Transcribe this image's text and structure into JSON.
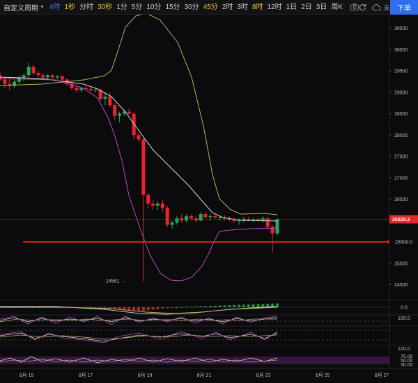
{
  "toolbar": {
    "custom_period": "自定义周期",
    "timeframes": [
      {
        "label": "4时",
        "state": "sel"
      },
      {
        "label": "1秒",
        "state": "active"
      },
      {
        "label": "分时",
        "state": ""
      },
      {
        "label": "30秒",
        "state": "active"
      },
      {
        "label": "1分",
        "state": ""
      },
      {
        "label": "5分",
        "state": ""
      },
      {
        "label": "10分",
        "state": ""
      },
      {
        "label": "15分",
        "state": ""
      },
      {
        "label": "30分",
        "state": ""
      },
      {
        "label": "45分",
        "state": "active"
      },
      {
        "label": "2时",
        "state": ""
      },
      {
        "label": "3时",
        "state": ""
      },
      {
        "label": "8时",
        "state": "active"
      },
      {
        "label": "12时",
        "state": ""
      },
      {
        "label": "1日",
        "state": ""
      },
      {
        "label": "2日",
        "state": ""
      },
      {
        "label": "3日",
        "state": ""
      },
      {
        "label": "周K",
        "state": ""
      }
    ],
    "cloud_label": "未命名",
    "order_button": "下单"
  },
  "chart_data": {
    "type": "candlestick",
    "y_ticks": [
      30500,
      30000,
      29500,
      29000,
      28500,
      28000,
      27500,
      27000,
      26500,
      26000,
      25500,
      25000,
      24500
    ],
    "ylim": [
      24150,
      30820
    ],
    "x_ticks": [
      "8月 15",
      "8月 17",
      "8月 19",
      "8月 21",
      "8月 23",
      "8月 25",
      "8月 27"
    ],
    "current_price": "26029.3",
    "horizontal_line": "25500.0",
    "low_marker": "24581 →",
    "colors": {
      "up": "#26a65b",
      "down": "#e8252d",
      "bb_outer": "#b7b25c",
      "bb_mid": "#d6d6d6",
      "bb_lower": "#b24fb6",
      "hline": "#e01818"
    },
    "candles": [
      [
        29400,
        29480,
        29250,
        29300
      ],
      [
        29300,
        29380,
        29100,
        29200
      ],
      [
        29200,
        29350,
        29050,
        29150
      ],
      [
        29150,
        29300,
        29100,
        29250
      ],
      [
        29250,
        29400,
        29200,
        29350
      ],
      [
        29350,
        29450,
        29250,
        29400
      ],
      [
        29400,
        29700,
        29350,
        29600
      ],
      [
        29600,
        29650,
        29400,
        29450
      ],
      [
        29450,
        29500,
        29350,
        29400
      ],
      [
        29400,
        29450,
        29300,
        29350
      ],
      [
        29350,
        29420,
        29300,
        29400
      ],
      [
        29400,
        29420,
        29320,
        29350
      ],
      [
        29350,
        29400,
        29300,
        29380
      ],
      [
        29380,
        29400,
        29250,
        29300
      ],
      [
        29300,
        29320,
        29150,
        29200
      ],
      [
        29200,
        29250,
        29050,
        29100
      ],
      [
        29100,
        29150,
        29000,
        29050
      ],
      [
        29050,
        29120,
        29000,
        29100
      ],
      [
        29100,
        29150,
        29050,
        29080
      ],
      [
        29080,
        29120,
        29020,
        29050
      ],
      [
        29050,
        29100,
        29000,
        29060
      ],
      [
        29060,
        29080,
        28800,
        28850
      ],
      [
        28850,
        29000,
        28700,
        28900
      ],
      [
        28900,
        29000,
        28650,
        28700
      ],
      [
        28700,
        28750,
        28350,
        28450
      ],
      [
        28450,
        28550,
        28300,
        28500
      ],
      [
        28500,
        28600,
        28450,
        28550
      ],
      [
        28550,
        28620,
        28480,
        28500
      ],
      [
        28500,
        28550,
        27900,
        28000
      ],
      [
        28000,
        28050,
        27850,
        27900
      ],
      [
        27900,
        27950,
        24581,
        26600
      ],
      [
        26600,
        26650,
        26300,
        26400
      ],
      [
        26400,
        26500,
        26250,
        26350
      ],
      [
        26350,
        26450,
        26250,
        26400
      ],
      [
        26400,
        26500,
        26200,
        26300
      ],
      [
        26300,
        26350,
        25850,
        25900
      ],
      [
        25900,
        26000,
        25800,
        25950
      ],
      [
        25950,
        26100,
        25900,
        26050
      ],
      [
        26050,
        26150,
        25950,
        26000
      ],
      [
        26000,
        26150,
        25950,
        26100
      ],
      [
        26100,
        26150,
        26000,
        26050
      ],
      [
        26050,
        26100,
        25950,
        26000
      ],
      [
        26000,
        26200,
        25980,
        26150
      ],
      [
        26150,
        26200,
        26050,
        26080
      ],
      [
        26080,
        26150,
        26000,
        26100
      ],
      [
        26100,
        26180,
        26050,
        26070
      ],
      [
        26070,
        26120,
        26000,
        26080
      ],
      [
        26080,
        26120,
        26000,
        26050
      ],
      [
        26050,
        26100,
        25980,
        26020
      ],
      [
        26020,
        26070,
        25950,
        25990
      ],
      [
        25990,
        26050,
        25900,
        26000
      ],
      [
        26000,
        26080,
        25950,
        26040
      ],
      [
        26040,
        26090,
        25980,
        26010
      ],
      [
        26010,
        26060,
        25960,
        26030
      ],
      [
        26030,
        26080,
        25980,
        26000
      ],
      [
        26000,
        26100,
        25950,
        26050
      ],
      [
        26050,
        26080,
        25800,
        25850
      ],
      [
        25850,
        25900,
        25250,
        25700
      ],
      [
        25700,
        26050,
        25650,
        26029
      ]
    ]
  }
}
